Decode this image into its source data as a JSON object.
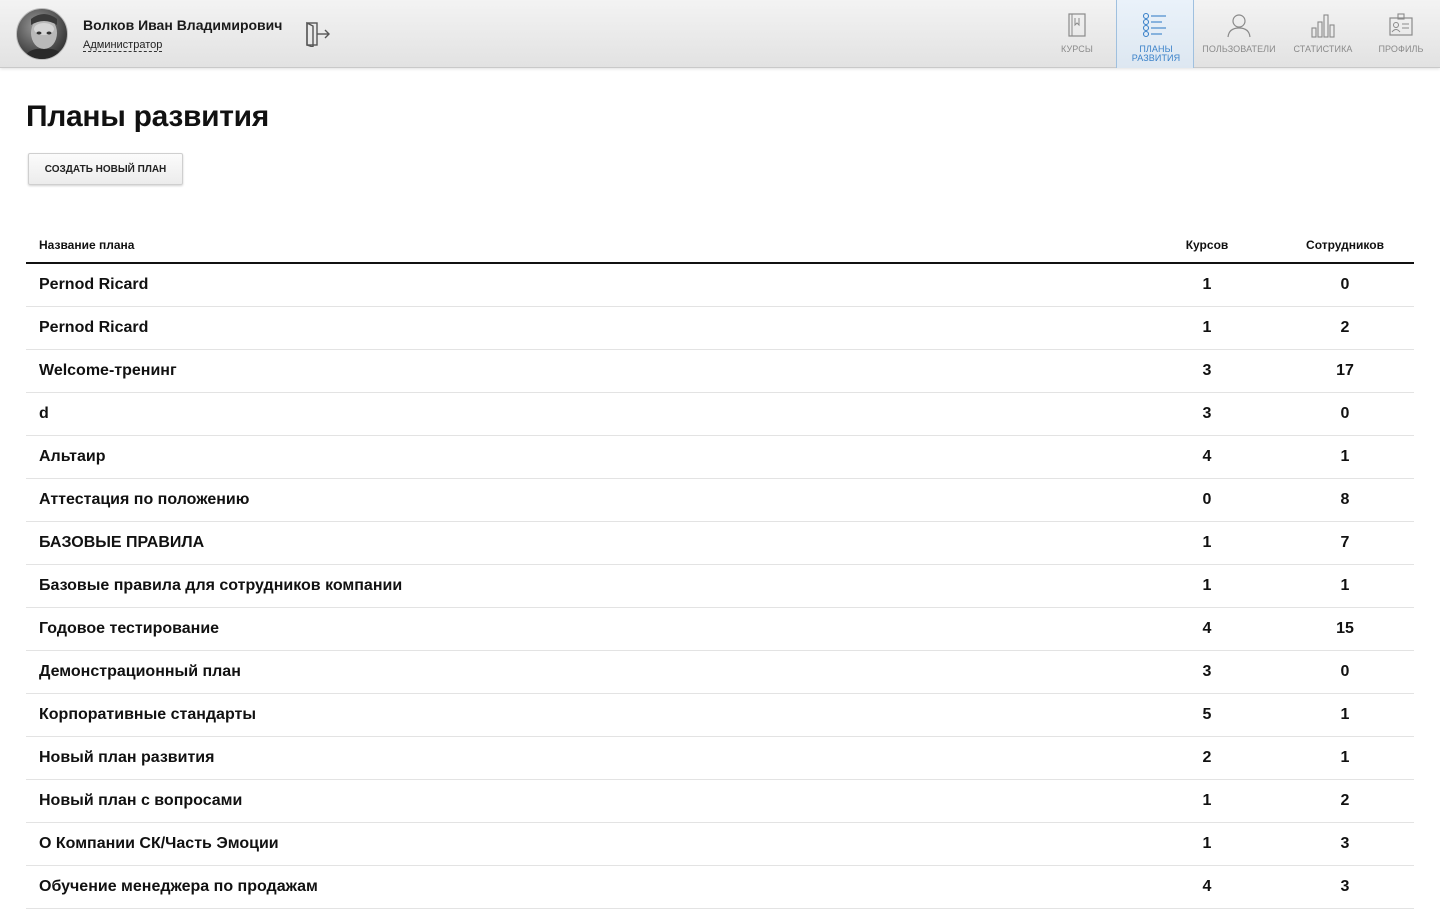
{
  "user": {
    "name": "Волков Иван Владимирович",
    "role": "Администратор"
  },
  "nav": [
    {
      "label": "КУРСЫ",
      "icon": "book-icon",
      "active": false
    },
    {
      "label": "ПЛАНЫ РАЗВИТИЯ",
      "icon": "checklist-icon",
      "active": true
    },
    {
      "label": "ПОЛЬЗОВАТЕЛИ",
      "icon": "users-icon",
      "active": false
    },
    {
      "label": "СТАТИСТИКА",
      "icon": "bar-chart-icon",
      "active": false
    },
    {
      "label": "ПРОФИЛЬ",
      "icon": "id-card-icon",
      "active": false
    }
  ],
  "page": {
    "title": "Планы развития",
    "create_label": "СОЗДАТЬ НОВЫЙ ПЛАН"
  },
  "table": {
    "headers": {
      "name": "Название плана",
      "courses": "Курсов",
      "staff": "Сотрудников"
    },
    "rows": [
      {
        "name": "Pernod Ricard",
        "courses": "1",
        "staff": "0"
      },
      {
        "name": "Pernod Ricard",
        "courses": "1",
        "staff": "2"
      },
      {
        "name": "Welcome-тренинг",
        "courses": "3",
        "staff": "17"
      },
      {
        "name": "d",
        "courses": "3",
        "staff": "0"
      },
      {
        "name": "Альтаир",
        "courses": "4",
        "staff": "1"
      },
      {
        "name": "Аттестация по положению",
        "courses": "0",
        "staff": "8"
      },
      {
        "name": "БАЗОВЫЕ ПРАВИЛА",
        "courses": "1",
        "staff": "7"
      },
      {
        "name": "Базовые правила для сотрудников компании",
        "courses": "1",
        "staff": "1"
      },
      {
        "name": "Годовое тестирование",
        "courses": "4",
        "staff": "15"
      },
      {
        "name": "Демонстрационный план",
        "courses": "3",
        "staff": "0"
      },
      {
        "name": "Корпоративные стандарты",
        "courses": "5",
        "staff": "1"
      },
      {
        "name": "Новый план развития",
        "courses": "2",
        "staff": "1"
      },
      {
        "name": "Новый план с вопросами",
        "courses": "1",
        "staff": "2"
      },
      {
        "name": "О Компании СК/Часть Эмоции",
        "courses": "1",
        "staff": "3"
      },
      {
        "name": "Обучение менеджера по продажам",
        "courses": "4",
        "staff": "3"
      }
    ]
  },
  "colors": {
    "accent": "#3b82c9",
    "nav_inactive": "#8a8a8a",
    "header_bg": "#e8e8e8"
  }
}
